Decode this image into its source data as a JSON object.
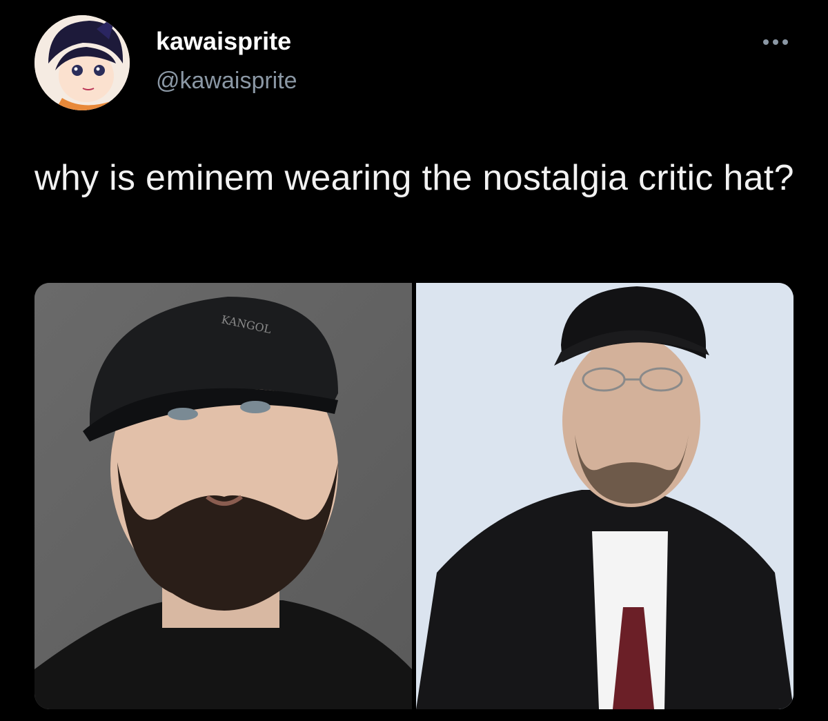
{
  "tweet": {
    "author": {
      "display_name": "kawaisprite",
      "handle": "@kawaisprite"
    },
    "text": "why is eminem wearing the nostalgia critic hat?",
    "more_icon": "more-horizontal-icon",
    "media": [
      {
        "type": "photo",
        "cap_text": "KANGOL"
      },
      {
        "type": "photo"
      }
    ]
  },
  "theme": {
    "background": "#000000",
    "text": "#e7e9ea",
    "secondary": "#8b98a5"
  }
}
